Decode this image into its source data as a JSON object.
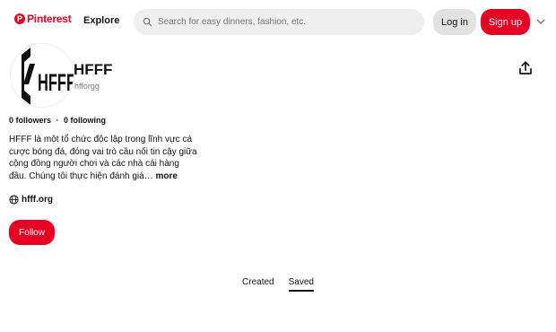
{
  "topbar": {
    "logo_text": "Pinterest",
    "logo_mark": "P",
    "explore_label": "Explore",
    "search": {
      "placeholder": "Search for easy dinners, fashion, etc.",
      "value": ""
    },
    "login_label": "Log in",
    "signup_label": "Sign up"
  },
  "profile": {
    "avatar_text": "HFFF",
    "name": "HFFF",
    "handle": "hfforgg",
    "followers": "0 followers",
    "dot": "·",
    "following": "0 following",
    "bio": "HFFF là một tổ chức độc lập trong lĩnh vực cá cược bóng đá, đóng vai trò cầu nối tin cậy giữa cộng đồng người chơi và các nhà cái hàng đầu. Chúng tôi thực hiện đánh giá…",
    "more_label": "more",
    "website": "hfff.org",
    "follow_label": "Follow"
  },
  "tabs": [
    {
      "label": "Created",
      "active": false
    },
    {
      "label": "Saved",
      "active": true
    }
  ],
  "colors": {
    "brand": "#e60023",
    "button_grey": "#e2e2e2",
    "search_bg": "#efefef"
  },
  "icons": [
    "pinterest-logo-icon",
    "search-icon",
    "chevron-down-icon",
    "share-icon",
    "globe-icon"
  ]
}
